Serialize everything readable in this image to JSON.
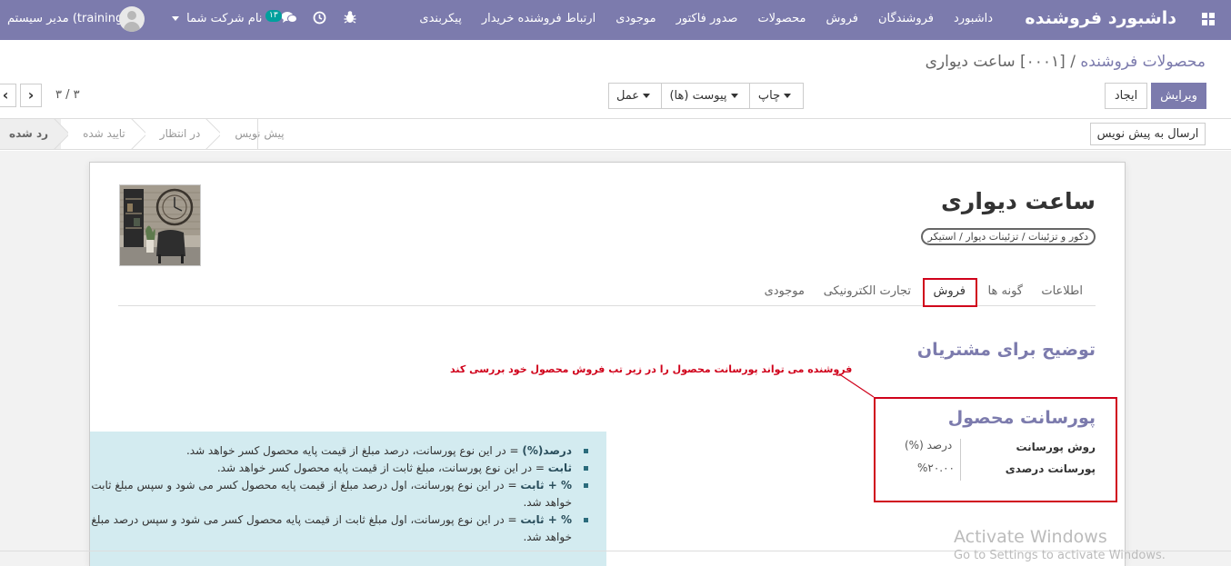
{
  "navbar": {
    "brand": "داشبورد فروشنده",
    "menu": [
      "داشبورد",
      "فروشندگان",
      "فروش",
      "محصولات",
      "صدور فاکتور",
      "موجودی",
      "ارتباط فروشنده خریدار",
      "پیکربندی"
    ],
    "company": "نام شرکت شما",
    "user": "مدیر سیستم (training)",
    "messages_count": "۱۳",
    "icons": [
      "apps-grid-icon",
      "bug-icon",
      "clock-icon",
      "chat-icon",
      "user-avatar"
    ]
  },
  "control_panel": {
    "breadcrumb_parent": "محصولات فروشنده",
    "breadcrumb_separator": "/",
    "breadcrumb_current": "[۰۰۰۱] ساعت دیواری",
    "edit_label": "ویرایش",
    "create_label": "ایجاد",
    "print_label": "چاپ",
    "attachment_label": "پیوست (ها)",
    "action_label": "عمل",
    "pager": "۳ / ۳",
    "prev_icon": "‹",
    "next_icon": "›"
  },
  "statusbar": {
    "send_to_draft_label": "ارسال به پیش نویس",
    "stages": [
      {
        "label": "رد شده",
        "active": true
      },
      {
        "label": "تایید شده",
        "active": false
      },
      {
        "label": "در انتظار",
        "active": false
      },
      {
        "label": "پیش نویس",
        "active": false
      }
    ]
  },
  "product": {
    "name": "ساعت دیواری",
    "category": "دکور و تزئینات / تزئینات دیوار / استیکر"
  },
  "tabs": [
    {
      "label": "اطلاعات",
      "active": false
    },
    {
      "label": "گونه ها",
      "active": false
    },
    {
      "label": "فروش",
      "active": true
    },
    {
      "label": "تجارت الکترونیکی",
      "active": false
    },
    {
      "label": "موجودی",
      "active": false
    }
  ],
  "sales_tab": {
    "customer_description_title": "توضیح برای مشتریان",
    "annotation": "فروشنده می تواند پورسانت محصول را در زیر تب فروش محصول خود بررسی کند",
    "commission_title": "پورسانت محصول",
    "commission_method_label": "روش پورسانت",
    "commission_method_value": "درصد (%)",
    "commission_percent_label": "پورسانت درصدی",
    "commission_percent_value": "%۲۰.۰۰"
  },
  "help": {
    "items": [
      {
        "term": "درصد(%)",
        "text": " = در این نوع پورسانت، درصد مبلغ از قیمت پایه محصول کسر خواهد شد."
      },
      {
        "term": "ثابت",
        "text": " = در این نوع پورسانت، مبلغ ثابت از قیمت پایه محصول کسر خواهد شد."
      },
      {
        "term": "% + ثابت",
        "text": " = در این نوع پورسانت، اول درصد مبلغ از قیمت پایه محصول کسر می شود و سپس مبلغ ثابت از مبلغ باقی مانده کسر خواهد شد."
      },
      {
        "term": "% + ثابت",
        "text": " = در این نوع پورسانت، اول مبلغ ثابت از قیمت پایه محصول کسر می شود و سپس درصد مبلغ از قیمت باقی مانده کسر خواهد شد."
      }
    ]
  },
  "watermark": {
    "line1": "Activate Windows",
    "line2": "Go to Settings to activate Windows."
  },
  "colors": {
    "brand": "#7c7bad",
    "highlight": "#d0021b",
    "help_bg": "#d3ebf0"
  }
}
